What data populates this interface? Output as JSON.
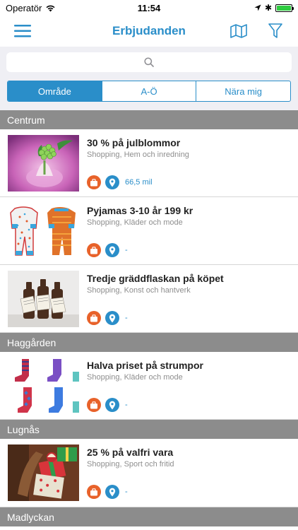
{
  "status": {
    "carrier": "Operatör",
    "time": "11:54"
  },
  "nav": {
    "title": "Erbjudanden"
  },
  "search": {
    "placeholder": ""
  },
  "segments": [
    {
      "label": "Område",
      "active": true
    },
    {
      "label": "A-Ö",
      "active": false
    },
    {
      "label": "Nära mig",
      "active": false
    }
  ],
  "sections": [
    {
      "name": "Centrum",
      "offers": [
        {
          "title": "30 % på julblommor",
          "category": "Shopping, Hem och inredning",
          "distance": "66,5 mil",
          "image": "flower-bulb-image"
        },
        {
          "title": "Pyjamas 3-10 år 199 kr",
          "category": "Shopping, Kläder och mode",
          "distance": "-",
          "image": "pyjamas-image"
        },
        {
          "title": "Tredje gräddflaskan på köpet",
          "category": "Shopping, Konst och hantverk",
          "distance": "-",
          "image": "cream-bottles-image"
        }
      ]
    },
    {
      "name": "Haggården",
      "offers": [
        {
          "title": "Halva priset på strumpor",
          "category": "Shopping, Kläder och mode",
          "distance": "-",
          "image": "socks-image"
        }
      ]
    },
    {
      "name": "Lugnås",
      "offers": [
        {
          "title": "25 % på valfri vara",
          "category": "Shopping, Sport och fritid",
          "distance": "-",
          "image": "gifts-image"
        }
      ]
    },
    {
      "name": "Madlyckan",
      "offers": []
    }
  ],
  "colors": {
    "accent": "#2a8ec9",
    "category_badge": "#e8622a",
    "section_header": "#8c8c8c"
  },
  "icons": {
    "menu": "hamburger-icon",
    "map": "map-icon",
    "filter": "filter-icon",
    "search": "search-icon",
    "category": "shopping-bag-icon",
    "location": "location-pin-icon"
  }
}
